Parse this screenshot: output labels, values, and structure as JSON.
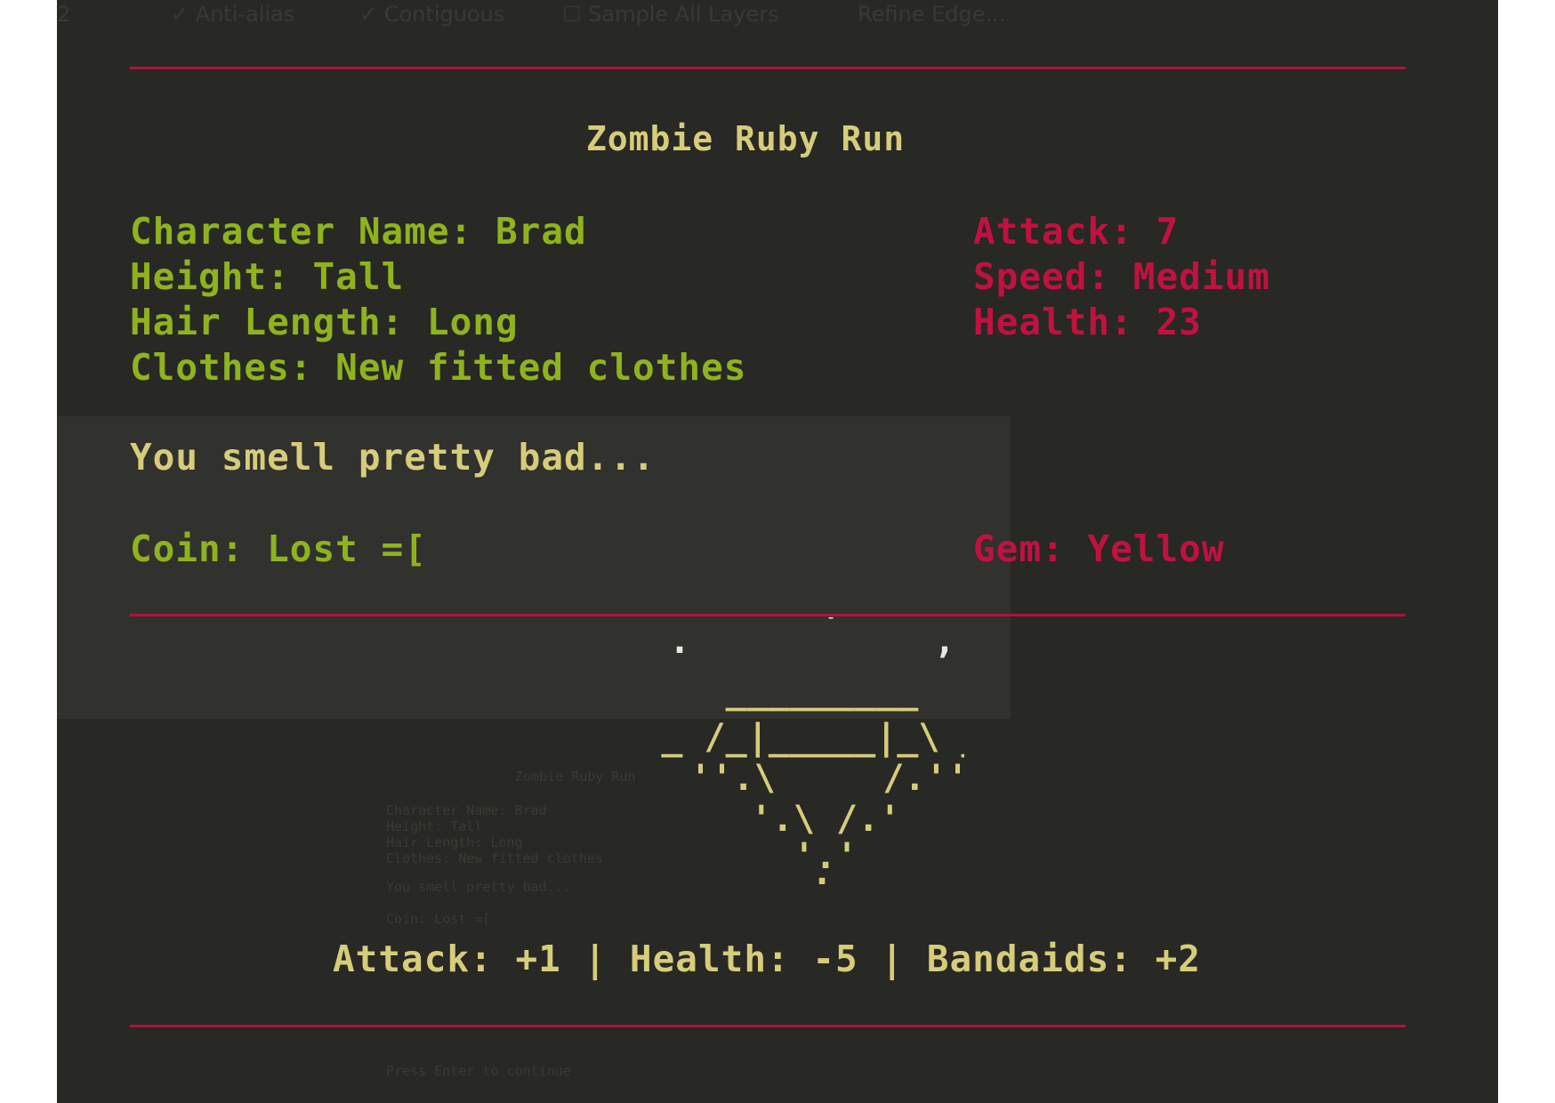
{
  "ghost_toolbar": {
    "item1": "2",
    "item2": "✓ Anti-alias",
    "item3": "✓ Contiguous",
    "item4": "☐ Sample All Layers",
    "item5": "Refine Edge..."
  },
  "game": {
    "title": "Zombie Ruby Run",
    "character": {
      "name": "Character Name: Brad",
      "height": "Height: Tall",
      "hair_length": "Hair Length: Long",
      "clothes": "Clothes: New fitted clothes"
    },
    "stats": {
      "attack": "Attack: 7",
      "speed": "Speed: Medium",
      "health": "Health: 23"
    },
    "message": "You smell pretty bad...",
    "coin": "Coin: Lost =[",
    "gem": "Gem: Yellow",
    "bonus": "Attack: +1 | Health: -5 | Bandaids: +2",
    "gem_art": {
      "sparkles": [
        ".",
        "'",
        ","
      ],
      "row1": "_________",
      "row2": "_ /_|_____|_\\ _",
      "row3": "''.\\     /.''",
      "row4": "'.\\ /.'",
      "row5": "'.'",
      "row6": "."
    }
  },
  "ghost_text": {
    "g_title": "Zombie Ruby Run",
    "g_line1": "Character Name: Brad",
    "g_line2": "Height: Tall",
    "g_line3": "Hair Length: Long",
    "g_line4": "Clothes: New fitted clothes",
    "g_msg": "You smell pretty bad...",
    "g_coin": "Coin: Lost =[",
    "g_footer": "Press Enter to continue"
  },
  "colors": {
    "background": "#282825",
    "rule": "#b5103c",
    "green": "#8fb31d",
    "red": "#c0123f",
    "yellow": "#d6cc7a"
  }
}
